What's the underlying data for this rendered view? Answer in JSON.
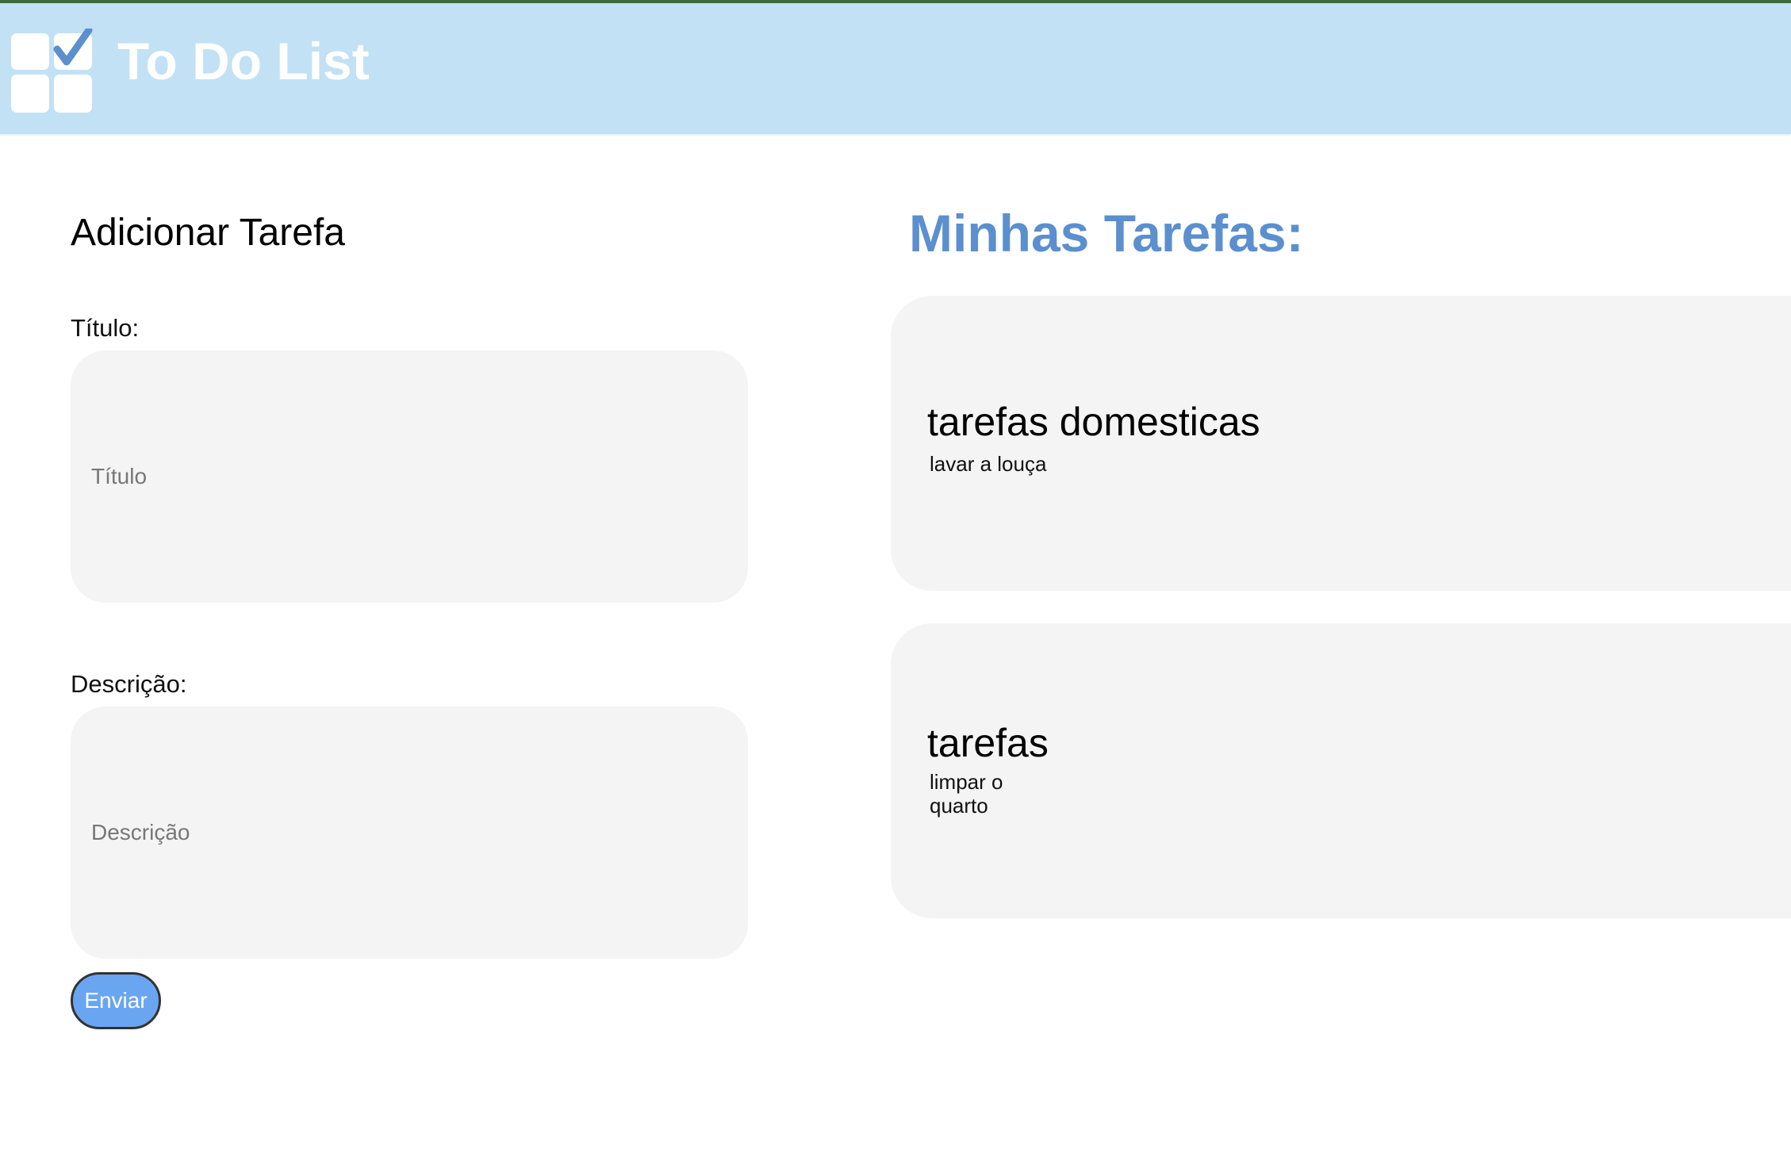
{
  "header": {
    "title": "To Do List",
    "logo_icon": "checklist-grid-icon",
    "background_color": "#c2e1f5"
  },
  "form": {
    "heading": "Adicionar Tarefa",
    "title_label": "Título:",
    "title_placeholder": "Título",
    "title_value": "",
    "description_label": "Descrição:",
    "description_placeholder": "Descrição",
    "description_value": "",
    "submit_label": "Enviar",
    "submit_color": "#6aa5f2"
  },
  "tasks": {
    "heading": "Minhas Tarefas:",
    "heading_color": "#5b8fce",
    "items": [
      {
        "title": "tarefas domesticas",
        "description": "lavar a louça"
      },
      {
        "title": "tarefas",
        "description": "limpar o quarto"
      }
    ]
  }
}
